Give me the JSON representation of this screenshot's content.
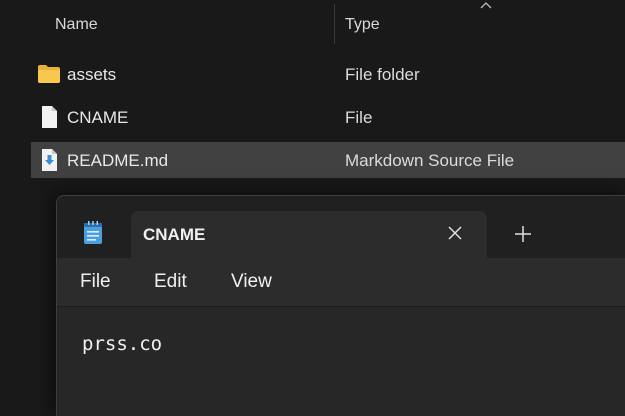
{
  "explorer": {
    "columns": {
      "name": "Name",
      "type": "Type"
    },
    "files": [
      {
        "name": "assets",
        "type": "File folder",
        "icon": "folder-icon",
        "selected": false
      },
      {
        "name": "CNAME",
        "type": "File",
        "icon": "file-icon",
        "selected": false
      },
      {
        "name": "README.md",
        "type": "Markdown Source File",
        "icon": "markdown-file-icon",
        "selected": true
      }
    ]
  },
  "notepad": {
    "app_icon": "notepad-icon",
    "tab_title": "CNAME",
    "close_icon": "close-icon",
    "new_tab_icon": "plus-icon",
    "menu": {
      "file": "File",
      "edit": "Edit",
      "view": "View"
    },
    "content": "prss.co"
  },
  "colors": {
    "background": "#191919",
    "selected_row": "#414141",
    "notepad_body": "#272727",
    "titlebar": "#202020",
    "folder": "#f3c343"
  }
}
